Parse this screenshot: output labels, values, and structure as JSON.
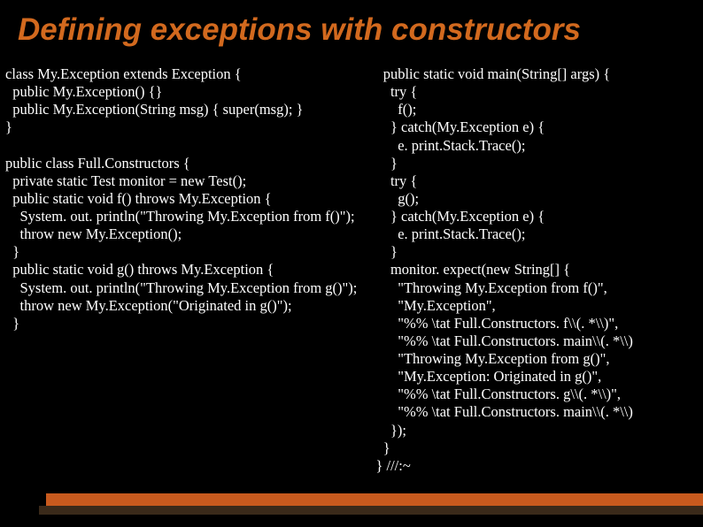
{
  "slide": {
    "title": "Defining exceptions with constructors",
    "leftCode": "class My.Exception extends Exception {\n  public My.Exception() {}\n  public My.Exception(String msg) { super(msg); }\n}\n\npublic class Full.Constructors {\n  private static Test monitor = new Test();\n  public static void f() throws My.Exception {\n    System. out. println(\"Throwing My.Exception from f()\");\n    throw new My.Exception();\n  }\n  public static void g() throws My.Exception {\n    System. out. println(\"Throwing My.Exception from g()\");\n    throw new My.Exception(\"Originated in g()\");\n  }",
    "rightCode": "  public static void main(String[] args) {\n    try {\n      f();\n    } catch(My.Exception e) {\n      e. print.Stack.Trace();\n    }\n    try {\n      g();\n    } catch(My.Exception e) {\n      e. print.Stack.Trace();\n    }\n    monitor. expect(new String[] {\n      \"Throwing My.Exception from f()\",\n      \"My.Exception\",\n      \"%% \\tat Full.Constructors. f\\\\(. *\\\\)\",\n      \"%% \\tat Full.Constructors. main\\\\(. *\\\\)\n      \"Throwing My.Exception from g()\",\n      \"My.Exception: Originated in g()\",\n      \"%% \\tat Full.Constructors. g\\\\(. *\\\\)\",\n      \"%% \\tat Full.Constructors. main\\\\(. *\\\\)\n    });\n  }\n} ///:~"
  }
}
